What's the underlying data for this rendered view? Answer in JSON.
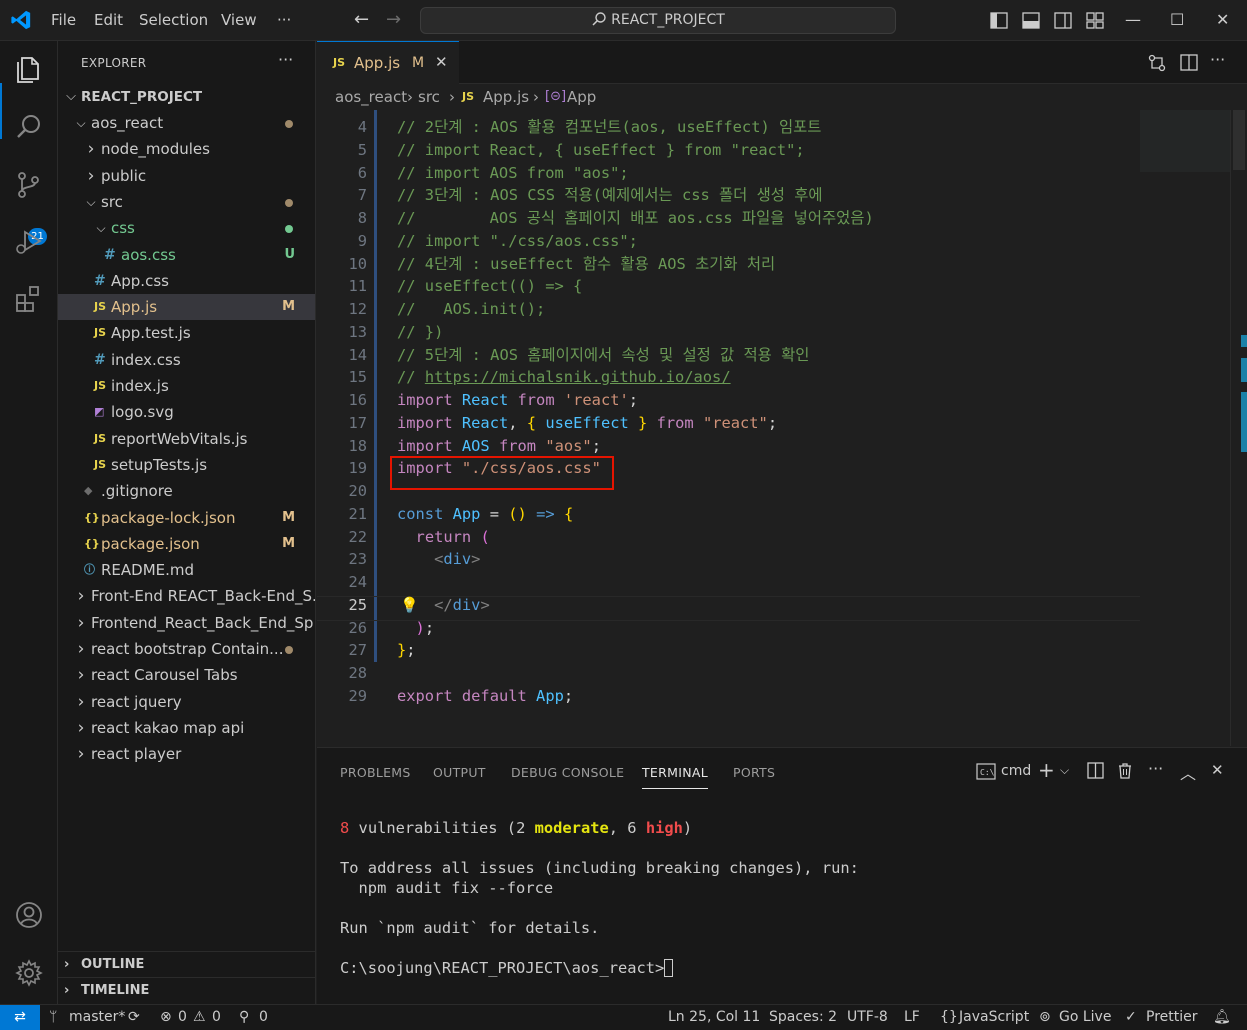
{
  "menu": [
    "File",
    "Edit",
    "Selection",
    "View",
    "···"
  ],
  "command_center": "REACT_PROJECT",
  "activity": {
    "scm_badge": "21"
  },
  "explorer": {
    "title": "EXPLORER",
    "root": "REACT_PROJECT",
    "items": [
      {
        "label": "aos_react",
        "type": "folder-open",
        "indent": 1,
        "status": "dot",
        "color": "#cccccc"
      },
      {
        "label": "node_modules",
        "type": "folder",
        "indent": 2,
        "color": "#cccccc"
      },
      {
        "label": "public",
        "type": "folder",
        "indent": 2,
        "color": "#cccccc"
      },
      {
        "label": "src",
        "type": "folder-open",
        "indent": 2,
        "status": "dot",
        "color": "#cccccc"
      },
      {
        "label": "css",
        "type": "folder-open",
        "indent": 3,
        "status": "dot-green",
        "color": "#73c991"
      },
      {
        "label": "aos.css",
        "type": "css",
        "indent": 4,
        "badge": "U",
        "color": "#73c991"
      },
      {
        "label": "App.css",
        "type": "css",
        "indent": 3,
        "color": "#cccccc"
      },
      {
        "label": "App.js",
        "type": "js",
        "indent": 3,
        "badge": "M",
        "color": "#e2c08d",
        "selected": true
      },
      {
        "label": "App.test.js",
        "type": "js",
        "indent": 3,
        "color": "#cccccc"
      },
      {
        "label": "index.css",
        "type": "css",
        "indent": 3,
        "color": "#cccccc"
      },
      {
        "label": "index.js",
        "type": "js",
        "indent": 3,
        "color": "#cccccc"
      },
      {
        "label": "logo.svg",
        "type": "svg",
        "indent": 3,
        "color": "#cccccc"
      },
      {
        "label": "reportWebVitals.js",
        "type": "js",
        "indent": 3,
        "color": "#cccccc"
      },
      {
        "label": "setupTests.js",
        "type": "js",
        "indent": 3,
        "color": "#cccccc"
      },
      {
        "label": ".gitignore",
        "type": "git",
        "indent": 2,
        "color": "#cccccc"
      },
      {
        "label": "package-lock.json",
        "type": "json",
        "indent": 2,
        "badge": "M",
        "color": "#e2c08d"
      },
      {
        "label": "package.json",
        "type": "json",
        "indent": 2,
        "badge": "M",
        "color": "#e2c08d"
      },
      {
        "label": "README.md",
        "type": "md",
        "indent": 2,
        "color": "#cccccc"
      },
      {
        "label": "Front-End REACT_Back-End_S...",
        "type": "folder",
        "indent": 1,
        "color": "#cccccc"
      },
      {
        "label": "Frontend_React_Back_End_Sp...",
        "type": "folder",
        "indent": 1,
        "color": "#cccccc"
      },
      {
        "label": "react bootstrap Contain...",
        "type": "folder",
        "indent": 1,
        "status": "dot",
        "color": "#cccccc"
      },
      {
        "label": "react Carousel Tabs",
        "type": "folder",
        "indent": 1,
        "color": "#cccccc"
      },
      {
        "label": "react jquery",
        "type": "folder",
        "indent": 1,
        "color": "#cccccc"
      },
      {
        "label": "react kakao map api",
        "type": "folder",
        "indent": 1,
        "color": "#cccccc"
      },
      {
        "label": "react player",
        "type": "folder",
        "indent": 1,
        "color": "#cccccc"
      }
    ],
    "outline": "OUTLINE",
    "timeline": "TIMELINE"
  },
  "tab": {
    "icon": "JS",
    "label": "App.js",
    "status": "M"
  },
  "breadcrumb": [
    "aos_react",
    "src",
    "App.js",
    "App"
  ],
  "code": [
    {
      "n": "4",
      "html": "<span class='cm'>// 2단계 : AOS 활용 컴포넌트(aos, useEffect) 임포트</span>"
    },
    {
      "n": "5",
      "html": "<span class='cm'>// import React, { useEffect } from \"react\";</span>"
    },
    {
      "n": "6",
      "html": "<span class='cm'>// import AOS from \"aos\";</span>"
    },
    {
      "n": "7",
      "html": "<span class='cm'>// 3단계 : AOS CSS 적용(예제에서는 css 폴더 생성 후에</span>"
    },
    {
      "n": "8",
      "html": "<span class='cm'>//        AOS 공식 홈페이지 배포 aos.css 파일을 넣어주었음)</span>"
    },
    {
      "n": "9",
      "html": "<span class='cm'>// import \"./css/aos.css\";</span>"
    },
    {
      "n": "10",
      "html": "<span class='cm'>// 4단계 : useEffect 함수 활용 AOS 초기화 처리</span>"
    },
    {
      "n": "11",
      "html": "<span class='cm'>// useEffect(() =&gt; {</span>"
    },
    {
      "n": "12",
      "html": "<span class='cm'>//   AOS.init();</span>"
    },
    {
      "n": "13",
      "html": "<span class='cm'>// })</span>"
    },
    {
      "n": "14",
      "html": "<span class='cm'>// 5단계 : AOS 홈페이지에서 속성 및 설정 값 적용 확인</span>"
    },
    {
      "n": "15",
      "html": "<span class='cm'>// <u>https://michalsnik.github.io/aos/</u></span>"
    },
    {
      "n": "16",
      "html": "<span class='kw'>import</span> <span class='var'>React</span> <span class='kw'>from</span> <span class='str'>'react'</span><span class='pun'>;</span>"
    },
    {
      "n": "17",
      "html": "<span class='kw'>import</span> <span class='var'>React</span><span class='pun'>, </span><span class='br1'>{</span> <span class='var'>useEffect</span> <span class='br1'>}</span> <span class='kw'>from</span> <span class='str'>\"react\"</span><span class='pun'>;</span>"
    },
    {
      "n": "18",
      "html": "<span class='kw'>import</span> <span class='var'>AOS</span> <span class='kw'>from</span> <span class='str'>\"aos\"</span><span class='pun'>;</span>"
    },
    {
      "n": "19",
      "html": "<span class='kw'>import</span> <span class='str'>\"./css/aos.css\"</span>"
    },
    {
      "n": "20",
      "html": ""
    },
    {
      "n": "21",
      "html": "<span class='kw2'>const</span> <span class='var'>App</span> <span class='pun'>=</span> <span class='br1'>()</span> <span class='kw2'>=&gt;</span> <span class='br1'>{</span>"
    },
    {
      "n": "22",
      "html": "  <span class='kw'>return</span> <span class='br2'>(</span>"
    },
    {
      "n": "23",
      "html": "    <span class='tag'>&lt;</span><span class='tagn'>div</span><span class='tag'>&gt;</span>"
    },
    {
      "n": "24",
      "html": ""
    },
    {
      "n": "25",
      "html": "    <span class='tag'>&lt;/</span><span class='tagn'>div</span><span class='tag'>&gt;</span>",
      "current": true
    },
    {
      "n": "26",
      "html": "  <span class='br2'>)</span><span class='pun'>;</span>"
    },
    {
      "n": "27",
      "html": "<span class='br1'>}</span><span class='pun'>;</span>"
    },
    {
      "n": "28",
      "html": ""
    },
    {
      "n": "29",
      "html": "<span class='kw'>export</span> <span class='kw'>default</span> <span class='var'>App</span><span class='pun'>;</span>"
    }
  ],
  "panel": {
    "tabs": [
      "PROBLEMS",
      "OUTPUT",
      "DEBUG CONSOLE",
      "TERMINAL",
      "PORTS"
    ],
    "active_tab": "TERMINAL",
    "shell": "cmd",
    "terminal": {
      "vuln_count": "8",
      "vuln_text_a": " vulnerabilities (2 ",
      "moderate": "moderate",
      "vuln_text_b": ", 6 ",
      "high": "high",
      "vuln_text_c": ")",
      "line2": "To address all issues (including breaking changes), run:",
      "line3": "  npm audit fix --force",
      "line4": "Run `npm audit` for details.",
      "prompt": "C:\\soojung\\REACT_PROJECT\\aos_react>"
    }
  },
  "status": {
    "branch": "master*",
    "errors": "0",
    "warnings": "0",
    "ports": "0",
    "position": "Ln 25, Col 11",
    "spaces": "Spaces: 2",
    "encoding": "UTF-8",
    "eol": "LF",
    "language": "JavaScript",
    "golive": "Go Live",
    "prettier": "Prettier"
  }
}
